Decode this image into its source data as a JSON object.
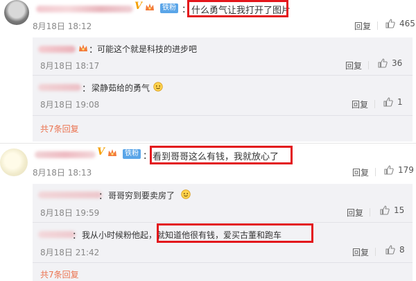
{
  "comments": [
    {
      "text": "什么勇气让我打开了图片",
      "time": "8月18日 18:12",
      "reply_label": "回复",
      "likes": "465",
      "badge_fan": "铁粉",
      "badge_v": "V",
      "replies": [
        {
          "text": "可能这个就是科技的进步吧",
          "time": "8月18日 18:17",
          "reply_label": "回复",
          "likes": "36"
        },
        {
          "text": "梁静茹给的勇气",
          "time": "8月18日 19:08",
          "reply_label": "回复",
          "likes": "1"
        }
      ],
      "total_replies": "共7条回复"
    },
    {
      "text": "看到哥哥这么有钱，我就放心了",
      "time": "8月18日 18:13",
      "reply_label": "回复",
      "likes": "179",
      "badge_fan": "铁粉",
      "badge_v": "V",
      "replies": [
        {
          "text": "哥哥穷到要卖房了",
          "time": "8月18日 19:59",
          "reply_label": "回复",
          "likes": "15"
        },
        {
          "text": "我从小时候粉他起，就知道他很有钱，爱买古董和跑车",
          "time": "8月18日 21:42",
          "reply_label": "回复",
          "likes": "8"
        }
      ],
      "total_replies": "共7条回复"
    }
  ],
  "colors": {
    "highlight_box": "#e3171c",
    "total_link": "#eb7350",
    "fan_badge": "#5aa5e8",
    "vip_v": "#f5a000"
  },
  "icons": {
    "like": "thumbs-up-icon",
    "emoji": "smiling-face-emoji",
    "crown": "crown-icon"
  }
}
